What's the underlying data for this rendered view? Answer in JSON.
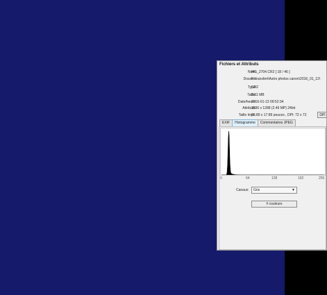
{
  "panel": {
    "title": "Fichiers et Attributs",
    "rows": [
      {
        "label": "Nom:",
        "value": "MG_2704.CR2   [ 18 / 46 ]"
      },
      {
        "label": "Dossier:",
        "value": "F:\\transfert\\Astro photos canon\\2016_01_12\\"
      },
      {
        "label": "Type:",
        "value": "CR2"
      },
      {
        "label": "Taille:",
        "value": "8.61 MB"
      },
      {
        "label": "Date/heure:",
        "value": "2016-01-13 09:52:34"
      },
      {
        "label": "Attributs:",
        "value": "1936 x 1288 (2.49 MP)  24bit"
      },
      {
        "label": "Taille Impr.:",
        "value": "26.89 x 17.89 pouces ,   DPI: 72 x 72"
      }
    ],
    "dpi_button": "DPI",
    "tabs": [
      "EXIF",
      "Histogramme",
      "Commentaires JPEG"
    ],
    "active_tab": 1,
    "histogram": {
      "x_ticks": [
        "0",
        "64",
        "128",
        "192",
        "255"
      ],
      "peak_at": 18
    },
    "canaux_label": "Canaux:",
    "canaux_value": "Gris",
    "couleurs_button": "# couleurs"
  },
  "colors": {
    "background": "#161a6a",
    "panel": "#f0f0f0",
    "active_tab": "#dff0fb"
  }
}
